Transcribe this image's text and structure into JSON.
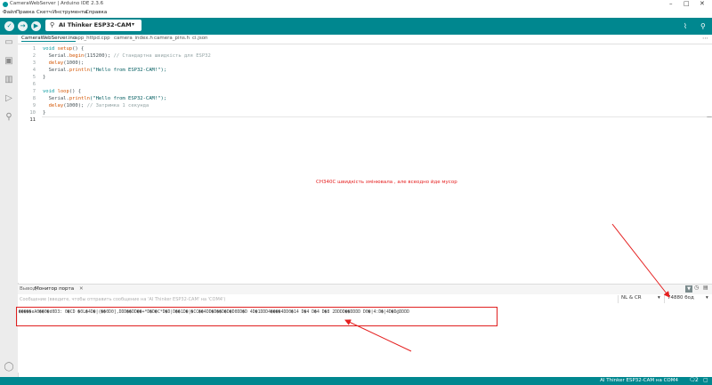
{
  "window": {
    "title": "CameraWebServer | Arduino IDE 2.3.6",
    "minimize": "–",
    "maximize": "□",
    "close": "✕"
  },
  "menu": [
    "Файл",
    "Правка",
    "Скетч",
    "Инструменты",
    "Справка"
  ],
  "toolbar": {
    "verify": "✓",
    "upload": "→",
    "debug": "▶",
    "board": "AI Thinker ESP32-CAM",
    "board_dropdown": "▾",
    "plotter": "⌇",
    "search": "⚲"
  },
  "tabs": [
    "CameraWebServer.ino",
    "app_httpd.cpp",
    "camera_index.h",
    "camera_pins.h",
    "ci.json"
  ],
  "tabs_more": "⋯",
  "code": {
    "line_numbers": [
      "1",
      "2",
      "3",
      "4",
      "5",
      "6",
      "7",
      "8",
      "9",
      "10",
      "11"
    ],
    "l1_kw": "void",
    "l1_fn": "setup",
    "l1_rest": "() {",
    "l2_pre": "  Serial.",
    "l2_fn": "begin",
    "l2_mid": "(115200); ",
    "l2_cm": "// Стандартна швидкість для ESP32",
    "l3_fn": "  delay",
    "l3_rest": "(1000);",
    "l4_pre": "  Serial.",
    "l4_fn": "println",
    "l4_str": "(\"Hello from ESP32-CAM!\");",
    "l5": "}",
    "l7_kw": "void",
    "l7_fn": "loop",
    "l7_rest": "() {",
    "l8_pre": "  Serial.",
    "l8_fn": "println",
    "l8_str": "(\"Hello from ESP32-CAM!\");",
    "l9_fn": "  delay",
    "l9_mid": "(1000); ",
    "l9_cm": "// Затримка 1 секунда",
    "l10": "}"
  },
  "annotation": "CH340C  швидкість змінювала , але всеодно йде мусор",
  "bottom_panel": {
    "tab_output": "Вывод",
    "tab_serial": "Монитор порта",
    "tab_close": "✕",
    "message_placeholder": "Сообщение (введите, чтобы отправить сообщение на 'AI Thinker ESP32-CAM' на 'COM4')",
    "line_ending": "NL & CR",
    "baud": "74880 бод",
    "output_line": "�����eA0��0�d0D3: 0�CD  �0L�4D�|(��0D0],DDD��DD��+*D�D�C*D�D|D��1D�|�CC��4DD�D��D�D�D0DD�D  4D�1DDD4����4DD0�14 D�4 D�4 D�8 2DDDD��DDDD D0�|4:D�|4D�D@DDDD"
  },
  "status": {
    "text": "AI Thinker ESP32-CAM на COM4",
    "notifications": "2",
    "notif_icon": "🗨",
    "layout_icon": "▢"
  },
  "colors": {
    "toolbar": "#00878f",
    "annotation": "#e52020"
  }
}
